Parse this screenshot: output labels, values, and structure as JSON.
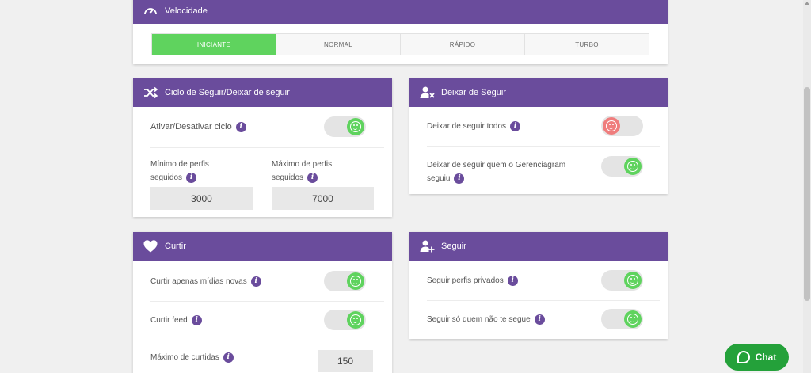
{
  "speed": {
    "title": "Velocidade",
    "icon": "speedometer-icon",
    "tabs": [
      {
        "label": "INICIANTE",
        "active": true
      },
      {
        "label": "NORMAL",
        "active": false
      },
      {
        "label": "RÁPIDO",
        "active": false
      },
      {
        "label": "TURBO",
        "active": false
      }
    ]
  },
  "cycle": {
    "title": "Ciclo de Seguir/Deixar de seguir",
    "icon": "shuffle-icon",
    "toggle_label": "Ativar/Desativar ciclo",
    "toggle_state": "on",
    "min_label_line1": "Mínimo de perfis",
    "min_label_line2": "seguidos",
    "min_value": "3000",
    "max_label_line1": "Máximo de perfis",
    "max_label_line2": "seguidos",
    "max_value": "7000"
  },
  "unfollow": {
    "title": "Deixar de Seguir",
    "icon": "user-remove-icon",
    "row1_label": "Deixar de seguir todos",
    "row1_state": "off",
    "row2_label_line1": "Deixar de seguir quem o Gerenciagram",
    "row2_label_line2": "seguiu",
    "row2_state": "on"
  },
  "like": {
    "title": "Curtir",
    "icon": "heart-icon",
    "row1_label": "Curtir apenas mídias novas",
    "row1_state": "on",
    "row2_label": "Curtir feed",
    "row2_state": "on",
    "max_label": "Máximo de curtidas",
    "max_value": "150"
  },
  "follow": {
    "title": "Seguir",
    "icon": "user-add-icon",
    "row1_label": "Seguir perfis privados",
    "row1_state": "on",
    "row2_label": "Seguir só quem não te segue",
    "row2_state": "on"
  },
  "chat": {
    "label": "Chat",
    "icon": "chat-bubble-icon"
  },
  "colors": {
    "header_purple": "#6a4c9c",
    "active_green": "#5fd35e",
    "off_red": "#ef7d7d",
    "chat_green": "#24a13a"
  }
}
